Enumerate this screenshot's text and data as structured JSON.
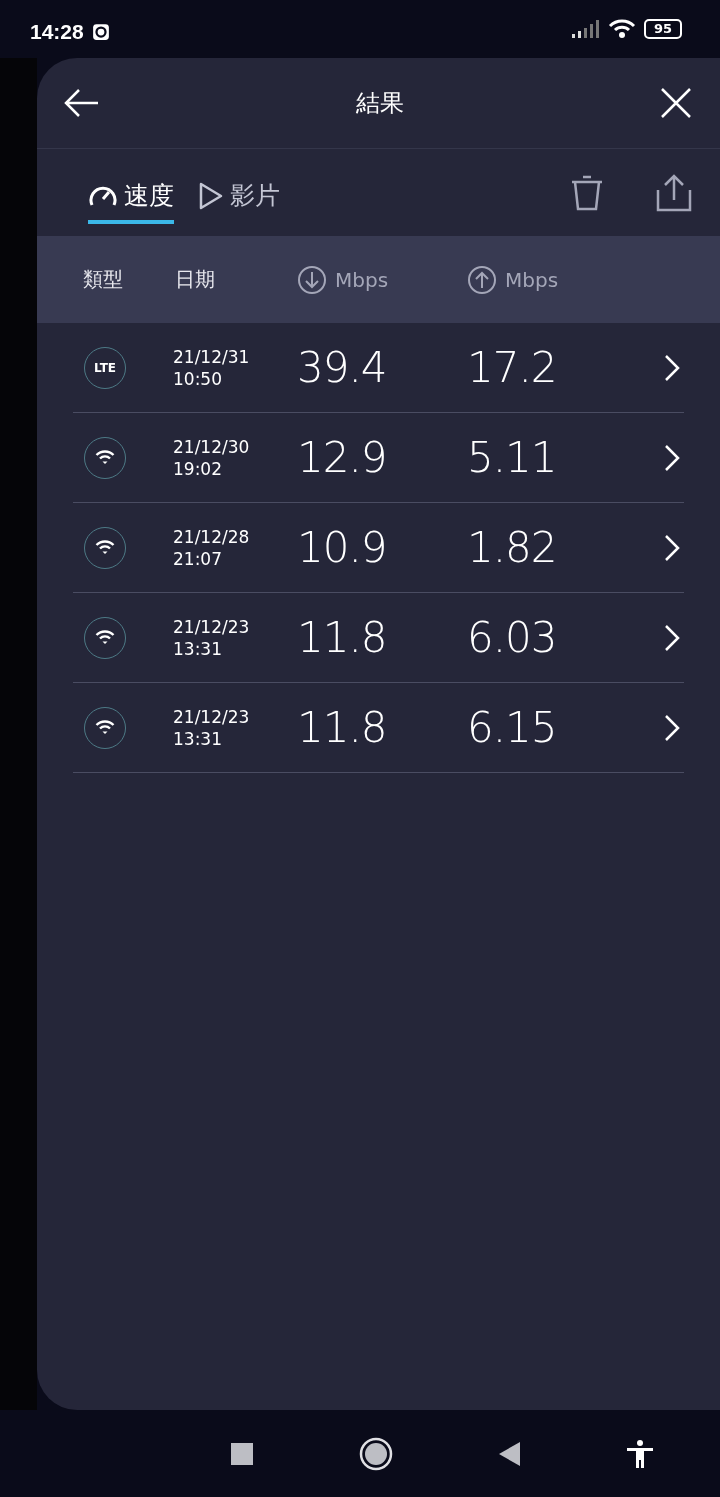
{
  "status_bar": {
    "time": "14:28",
    "battery": "95"
  },
  "header": {
    "title": "結果"
  },
  "tabs": [
    {
      "label": "速度",
      "kind": "speed",
      "selected": true
    },
    {
      "label": "影片",
      "kind": "video",
      "selected": false
    }
  ],
  "table": {
    "columns": [
      {
        "label": "類型",
        "kind": "text"
      },
      {
        "label": "日期",
        "kind": "text"
      },
      {
        "label": "Mbps",
        "kind": "download"
      },
      {
        "label": "Mbps",
        "kind": "upload"
      }
    ],
    "rows": [
      {
        "kind": "lte",
        "type_label": "LTE",
        "date": "21/12/31",
        "time": "10:50",
        "download": "39.4",
        "upload": "17.2"
      },
      {
        "kind": "wifi",
        "date": "21/12/30",
        "time": "19:02",
        "download": "12.9",
        "upload": "5.11"
      },
      {
        "kind": "wifi",
        "date": "21/12/28",
        "time": "21:07",
        "download": "10.9",
        "upload": "1.82"
      },
      {
        "kind": "wifi",
        "date": "21/12/23",
        "time": "13:31",
        "download": "11.8",
        "upload": "6.03"
      },
      {
        "kind": "wifi",
        "date": "21/12/23",
        "time": "13:31",
        "download": "11.8",
        "upload": "6.15"
      }
    ]
  }
}
